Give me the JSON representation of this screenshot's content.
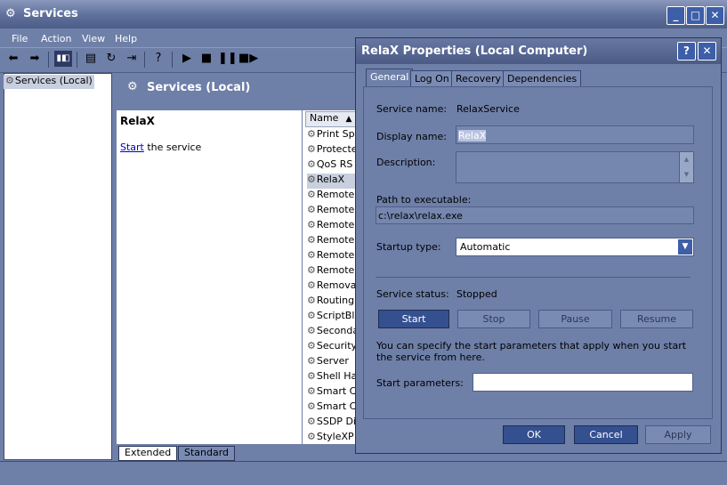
{
  "window": {
    "title": "Services"
  },
  "menu": [
    "File",
    "Action",
    "View",
    "Help"
  ],
  "tree": {
    "selected": "Services (Local)"
  },
  "pane": {
    "title": "Services (Local)",
    "service_name": "RelaX",
    "start_link": "Start",
    "start_suffix": " the service"
  },
  "list": {
    "header": "Name",
    "rows": [
      "Print Sp",
      "Protecte",
      "QoS RS",
      "RelaX",
      "Remote",
      "Remote",
      "Remote",
      "Remote",
      "Remote",
      "Remote",
      "Remova",
      "Routing",
      "ScriptBl",
      "Seconda",
      "Security",
      "Server",
      "Shell Ha",
      "Smart C",
      "Smart C",
      "SSDP Di",
      "StyleXP"
    ]
  },
  "bottom_tabs": [
    "Extended",
    "Standard"
  ],
  "dialog": {
    "title": "RelaX Properties (Local Computer)",
    "tabs": [
      "General",
      "Log On",
      "Recovery",
      "Dependencies"
    ],
    "service_name_label": "Service name:",
    "service_name_value": "RelaxService",
    "display_name_label": "Display name:",
    "display_name_value": "RelaX",
    "description_label": "Description:",
    "description_value": "",
    "path_label": "Path to executable:",
    "path_value": "c:\\relax\\relax.exe",
    "startup_label": "Startup type:",
    "startup_value": "Automatic",
    "status_label": "Service status:",
    "status_value": "Stopped",
    "buttons": {
      "start": "Start",
      "stop": "Stop",
      "pause": "Pause",
      "resume": "Resume"
    },
    "hint": "You can specify the start parameters that apply when you start the service from here.",
    "params_label": "Start parameters:",
    "params_value": "",
    "ok": "OK",
    "cancel": "Cancel",
    "apply": "Apply"
  }
}
